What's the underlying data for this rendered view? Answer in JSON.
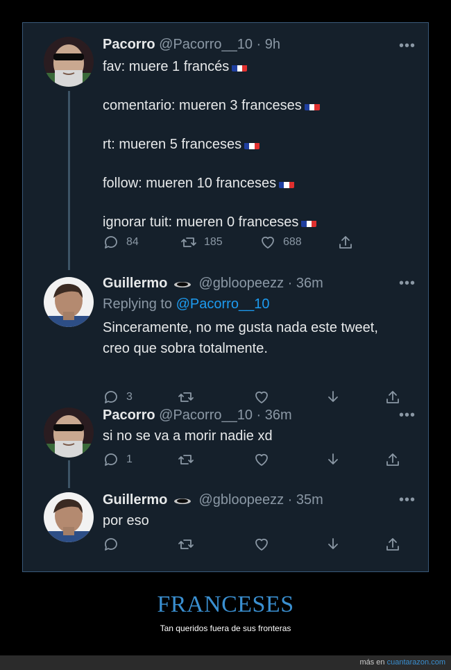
{
  "tweets": [
    {
      "name": "Pacorro",
      "handle": "@Pacorro__10",
      "time": "9h",
      "has_badge": false,
      "lines": [
        "fav: muere 1 francés",
        "comentario: mueren 3 franceses",
        "rt: mueren 5 franceses",
        "follow: mueren 10 franceses",
        "ignorar tuit: mueren 0 franceses"
      ],
      "replies": "84",
      "retweets": "185",
      "likes": "688"
    },
    {
      "name": "Guillermo",
      "handle": "@gbloopeezz",
      "time": "36m",
      "has_badge": true,
      "replying_label": "Replying to",
      "replying_to": "@Pacorro__10",
      "lines": [
        "Sinceramente, no me gusta nada este tweet,",
        "creo que sobra totalmente."
      ],
      "replies": "3"
    },
    {
      "name": "Pacorro",
      "handle": "@Pacorro__10",
      "time": "36m",
      "has_badge": false,
      "lines": [
        "si no se va a morir nadie xd"
      ],
      "replies": "1"
    },
    {
      "name": "Guillermo",
      "handle": "@gbloopeezz",
      "time": "35m",
      "has_badge": true,
      "lines": [
        "por eso"
      ]
    }
  ],
  "more_symbol": "•••",
  "separator": "·",
  "caption": {
    "title": "FRANCESES",
    "subtitle": "Tan queridos fuera de sus fronteras"
  },
  "footer": {
    "prefix": "más en",
    "site": "cuantarazon.com"
  },
  "colors": {
    "background": "#15202b",
    "accent": "#1d9bf0",
    "muted": "#8b98a5",
    "caption": "#3a8fd0"
  },
  "icons": [
    "reply-icon",
    "retweet-icon",
    "like-icon",
    "download-icon",
    "share-icon",
    "more-icon",
    "france-flag-icon"
  ]
}
